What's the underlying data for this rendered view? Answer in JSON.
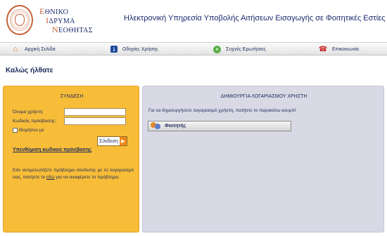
{
  "header": {
    "org_lines": [
      {
        "cap": "Ε",
        "rest": "ΘΝΙΚΟ"
      },
      {
        "cap": "Ι",
        "rest": "ΔΡΥΜΑ"
      },
      {
        "cap": "Ν",
        "rest": "ΕΟΘΗΤΑΣ"
      }
    ],
    "title": "Ηλεκτρονική Υπηρεσία Υποβολής Αιτήσεων Εισαγωγής σε Φοιτητικές Εστίες"
  },
  "nav": [
    {
      "label": "Αρχική Σελίδα",
      "icon": "home-icon"
    },
    {
      "label": "Οδηγίες Χρήσης",
      "icon": "info-icon"
    },
    {
      "label": "Συχνές Ερωτήσεις",
      "icon": "faq-icon"
    },
    {
      "label": "Επικοινωνία",
      "icon": "phone-icon"
    }
  ],
  "welcome": "Καλώς ήλθατε",
  "login": {
    "title": "ΣΥΝΔΕΣΗ",
    "username_label": "Όνομα χρήστη:",
    "username_value": "",
    "password_label": "Κωδικός πρόσβασης:",
    "password_value": "",
    "remember_label": "Θυμήσου με",
    "remember_checked": false,
    "submit_label": "Σύνδεση",
    "forgot_label": "Υπενθύμιση κωδικού πρόσβασης",
    "help_before": "Εάν αντιμετωπίζετε πρόβλημα σύνδεσης με το λογαριασμό σας, πατήστε το ",
    "help_link": "εδώ",
    "help_after": " για να αναφέρετε το πρόβλημα."
  },
  "account": {
    "title": "ΔΗΜΙΟΥΡΓΙΑ ΛΟΓΑΡΙΑΣΜΟΥ ΧΡΗΣΤΗ",
    "instructions": "Για να δημιουργήσετε λογαριασμό χρήστη, πατήστε το παρακάτω κουμπί",
    "student_button": "Φοιτητής",
    "student_icon": "users-icon"
  },
  "colors": {
    "login_panel": "#f8bd38",
    "account_panel": "#d8d9e5",
    "text": "#1a2a5a",
    "accent": "#c4623a"
  }
}
